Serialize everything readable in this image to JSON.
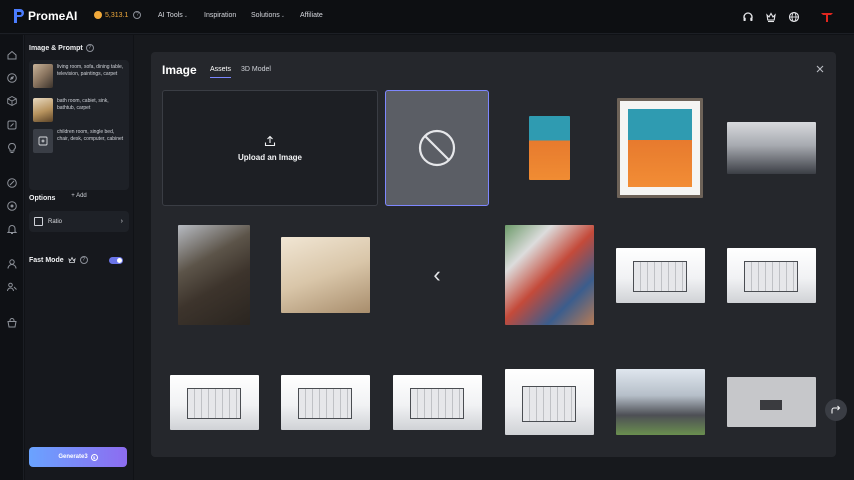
{
  "topbar": {
    "brand": "PromeAI",
    "credits": "5,313.1",
    "nav": [
      {
        "label": "AI Tools",
        "has_caret": true
      },
      {
        "label": "Inspiration",
        "has_caret": false
      },
      {
        "label": "Solutions",
        "has_caret": true
      },
      {
        "label": "Affiliate",
        "has_caret": false
      }
    ],
    "right_icons": [
      "headset-icon",
      "crown-icon",
      "globe-icon",
      "user-avatar-icon"
    ]
  },
  "rail": {
    "icons": [
      "home-icon",
      "explore-icon",
      "cube-icon",
      "edit-icon",
      "bulb-icon",
      "compass-icon",
      "palette-icon",
      "bell-icon",
      "user-icon",
      "team-icon",
      "shop-icon"
    ]
  },
  "sidebar": {
    "image_prompt_title": "Image & Prompt",
    "prompts": [
      {
        "text": "living room, sofa, dining table, television, paintings, carpet"
      },
      {
        "text": "bath room, cabiet, sink, bathtub, carpet"
      },
      {
        "text": "children room, single bed, chair, desk, computer, cabinet"
      }
    ],
    "add_label": "+ Add",
    "options_title": "Options",
    "ratio_label": "Ratio",
    "fast_mode_label": "Fast Mode",
    "fast_mode_on": true,
    "generate_label": "Generate3"
  },
  "modal": {
    "title": "Image",
    "tabs": [
      {
        "label": "Assets",
        "active": true
      },
      {
        "label": "3D Model",
        "active": false
      }
    ],
    "upload_label": "Upload an Image",
    "accent": "#7e87ff"
  }
}
